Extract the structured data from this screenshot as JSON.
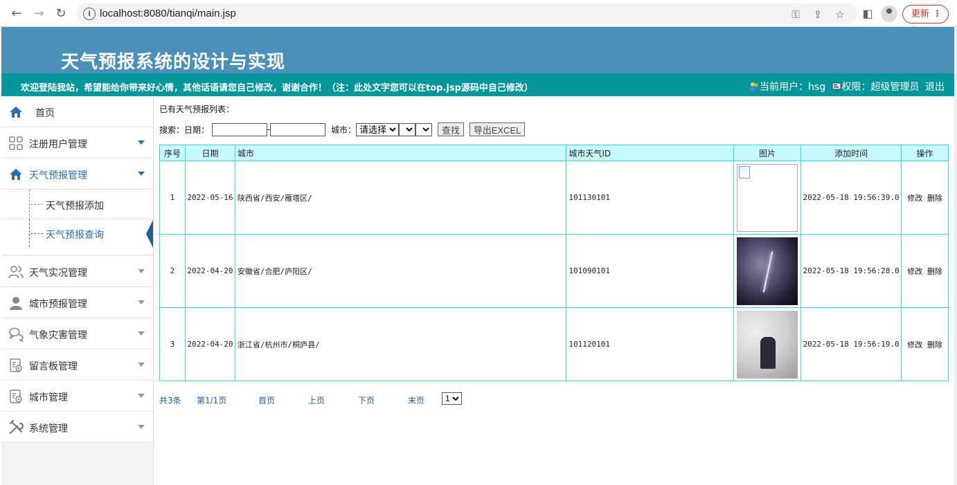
{
  "browser": {
    "url": "localhost:8080/tianqi/main.jsp",
    "update_label": "更新"
  },
  "header": {
    "title": "天气预报系统的设计与实现",
    "welcome": "欢迎登陆我站，希望能给你带来好心情，其他话语请您自己修改，谢谢合作！（注：此处文字您可以在top.jsp源码中自己修改）",
    "current_user_label": "当前用户：",
    "current_user": "hsg",
    "role_label": "权限：",
    "role": "超级管理员",
    "logout": "退出"
  },
  "sidebar": {
    "home": "首页",
    "items": [
      {
        "label": "注册用户管理",
        "icon": "grid-icon"
      },
      {
        "label": "天气预报管理",
        "icon": "home-icon"
      },
      {
        "label": "天气实况管理",
        "icon": "users-icon"
      },
      {
        "label": "城市预报管理",
        "icon": "person-icon"
      },
      {
        "label": "气象灾害管理",
        "icon": "chat-icon"
      },
      {
        "label": "留言板管理",
        "icon": "document-icon"
      },
      {
        "label": "城市管理",
        "icon": "document-icon"
      },
      {
        "label": "系统管理",
        "icon": "tools-icon"
      }
    ],
    "sub_items": [
      "天气预报添加",
      "天气预报查询"
    ]
  },
  "main": {
    "list_title": "已有天气预报列表：",
    "search_label": "搜索：",
    "date_label": "日期：",
    "date_sep": "-",
    "date_from_value": "",
    "date_to_value": "",
    "city_label": "城市：",
    "city_select": "请选择",
    "search_button": "查找",
    "export_button": "导出EXCEL",
    "columns": [
      "序号",
      "日期",
      "城市",
      "城市天气ID",
      "图片",
      "添加时间",
      "操作"
    ],
    "rows": [
      {
        "no": "1",
        "date": "2022-05-16",
        "city": "陕西省/西安/雁塔区/",
        "city_id": "101130101",
        "picture": "broken-image",
        "added": "2022-05-18 19:56:39.0",
        "edit": "修改",
        "delete": "删除"
      },
      {
        "no": "2",
        "date": "2022-04-20",
        "city": "安徽省/合肥/庐阳区/",
        "city_id": "101090101",
        "picture": "lightning-storm",
        "added": "2022-05-18 19:56:28.0",
        "edit": "修改",
        "delete": "删除"
      },
      {
        "no": "3",
        "date": "2022-04-20",
        "city": "浙江省/杭州市/桐庐县/",
        "city_id": "101120101",
        "picture": "snow-street",
        "added": "2022-05-18 19:56:19.0",
        "edit": "修改",
        "delete": "删除"
      }
    ]
  },
  "pager": {
    "total": "共3条",
    "page": "第1/1页",
    "first": "首页",
    "prev": "上页",
    "next": "下页",
    "last": "末页",
    "select": "1"
  }
}
